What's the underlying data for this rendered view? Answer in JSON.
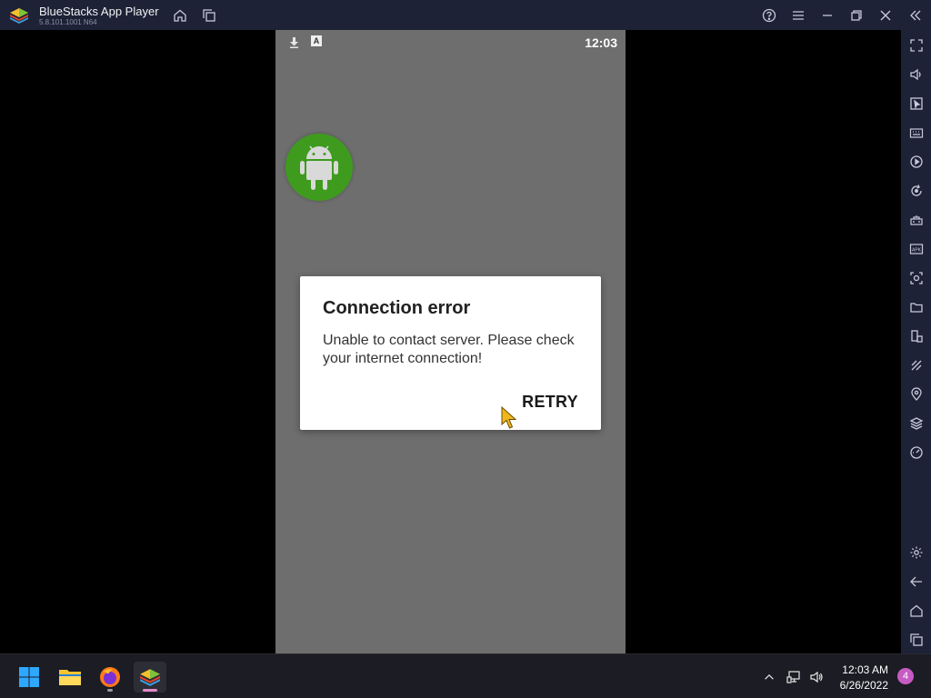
{
  "window": {
    "title": "BlueStacks App Player",
    "version": "5.8.101.1001 N64"
  },
  "android": {
    "status_time": "12:03",
    "status_keyboard_letter": "A"
  },
  "dialog": {
    "title": "Connection error",
    "message": "Unable to contact server. Please check your internet connection!",
    "retry_label": "RETRY"
  },
  "taskbar": {
    "clock_time": "12:03 AM",
    "clock_date": "6/26/2022",
    "notification_count": "4"
  },
  "colors": {
    "titlebar": "#1e2237",
    "android_bg": "#6e6e6e",
    "app_icon_green": "#3e9b1e",
    "taskbar": "#1c1c24",
    "badge": "#c75bc4"
  }
}
